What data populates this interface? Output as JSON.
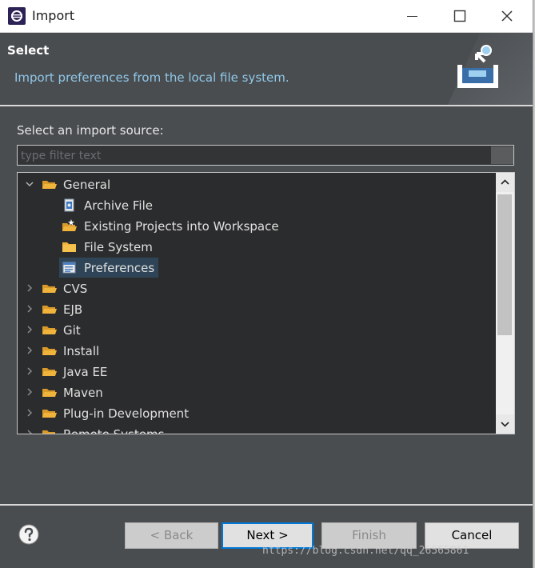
{
  "window": {
    "title": "Import",
    "controls": [
      "minimize",
      "maximize",
      "close"
    ]
  },
  "banner": {
    "title": "Select",
    "description": "Import preferences from the local file system."
  },
  "source": {
    "label": "Select an import source:",
    "filter_placeholder": "type filter text",
    "filter_value": ""
  },
  "tree": {
    "items": [
      {
        "label": "General",
        "expanded": true,
        "level": 0,
        "icon": "folder-open-icon"
      },
      {
        "label": "Archive File",
        "level": 1,
        "icon": "archive-file-icon"
      },
      {
        "label": "Existing Projects into Workspace",
        "level": 1,
        "icon": "projects-folder-icon"
      },
      {
        "label": "File System",
        "level": 1,
        "icon": "folder-icon"
      },
      {
        "label": "Preferences",
        "level": 1,
        "icon": "preferences-icon",
        "selected": true
      },
      {
        "label": "CVS",
        "expanded": false,
        "level": 0,
        "icon": "folder-open-icon"
      },
      {
        "label": "EJB",
        "expanded": false,
        "level": 0,
        "icon": "folder-open-icon"
      },
      {
        "label": "Git",
        "expanded": false,
        "level": 0,
        "icon": "folder-open-icon"
      },
      {
        "label": "Install",
        "expanded": false,
        "level": 0,
        "icon": "folder-open-icon"
      },
      {
        "label": "Java EE",
        "expanded": false,
        "level": 0,
        "icon": "folder-open-icon"
      },
      {
        "label": "Maven",
        "expanded": false,
        "level": 0,
        "icon": "folder-open-icon"
      },
      {
        "label": "Plug-in Development",
        "expanded": false,
        "level": 0,
        "icon": "folder-open-icon"
      },
      {
        "label": "Remote Systems",
        "expanded": false,
        "level": 0,
        "icon": "folder-open-icon"
      }
    ]
  },
  "buttons": {
    "back": "< Back",
    "next": "Next >",
    "finish": "Finish",
    "cancel": "Cancel"
  },
  "watermark": "https://blog.csdn.net/qq_26565861",
  "colors": {
    "background": "#4a4d50",
    "tree_background": "#2b2c2d",
    "description": "#8ec7e8",
    "selection": "#2f4557",
    "default_button_border": "#0078d7",
    "folder": "#f0b43c"
  }
}
